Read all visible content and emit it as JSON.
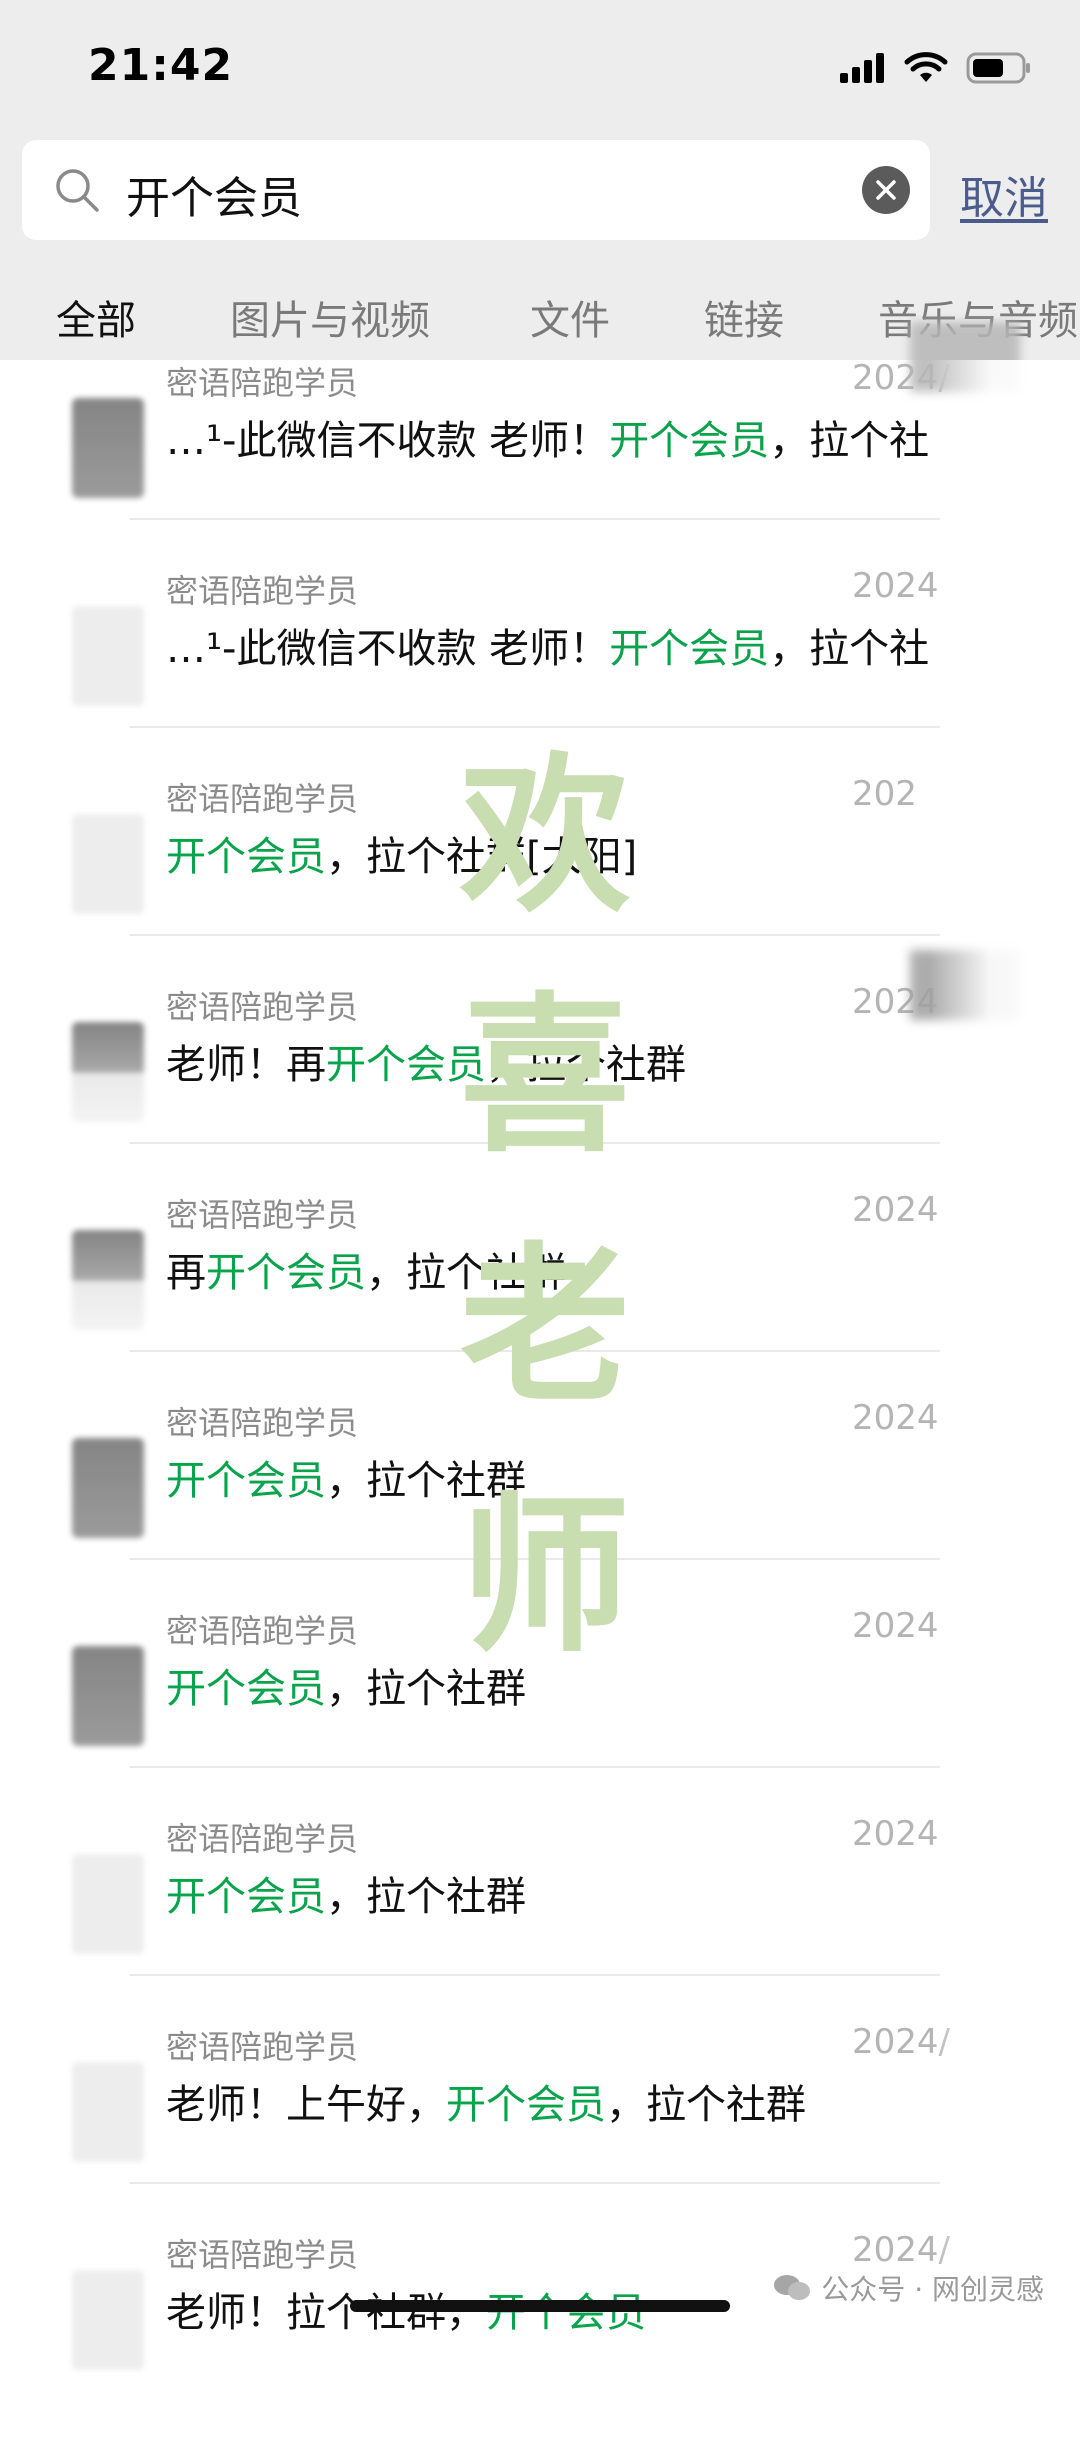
{
  "status_bar": {
    "time": "21:42"
  },
  "search": {
    "query": "开个会员",
    "cancel_label": "取消"
  },
  "tabs": [
    {
      "label": "全部"
    },
    {
      "label": "图片与视频"
    },
    {
      "label": "文件"
    },
    {
      "label": "链接"
    },
    {
      "label": "音乐与音频"
    }
  ],
  "results": [
    {
      "name": "密语陪跑学员",
      "date": "2024/",
      "pre": "…¹-此微信不收款 老师！",
      "hl": "开个会员",
      "post": "，拉个社"
    },
    {
      "name": "密语陪跑学员",
      "date": "2024",
      "pre": "…¹-此微信不收款 老师！",
      "hl": "开个会员",
      "post": "，拉个社"
    },
    {
      "name": "密语陪跑学员",
      "date": "202",
      "pre": "",
      "hl": "开个会员",
      "post": "，拉个社群[太阳]"
    },
    {
      "name": "密语陪跑学员",
      "date": "2024",
      "pre": "老师！再",
      "hl": "开个会员",
      "post": "，拉个社群"
    },
    {
      "name": "密语陪跑学员",
      "date": "2024",
      "pre": "再",
      "hl": "开个会员",
      "post": "，拉个社群"
    },
    {
      "name": "密语陪跑学员",
      "date": "2024",
      "pre": "",
      "hl": "开个会员",
      "post": "，拉个社群"
    },
    {
      "name": "密语陪跑学员",
      "date": "2024",
      "pre": "",
      "hl": "开个会员",
      "post": "，拉个社群"
    },
    {
      "name": "密语陪跑学员",
      "date": "2024",
      "pre": "",
      "hl": "开个会员",
      "post": "，拉个社群"
    },
    {
      "name": "密语陪跑学员",
      "date": "2024/",
      "pre": "老师！上午好，",
      "hl": "开个会员",
      "post": "，拉个社群"
    },
    {
      "name": "密语陪跑学员",
      "date": "2024/",
      "pre": "老师！拉个社群，",
      "hl": "开个会员",
      "post": ""
    }
  ],
  "watermark": {
    "chars": [
      "欢",
      "喜",
      "老",
      "师"
    ],
    "color": "#c8ddb0"
  },
  "footer": {
    "text": "公众号 · 网创灵感"
  },
  "colors": {
    "highlight": "#08a34a",
    "cancel": "#4b5c8c",
    "header_bg": "#ededed"
  }
}
